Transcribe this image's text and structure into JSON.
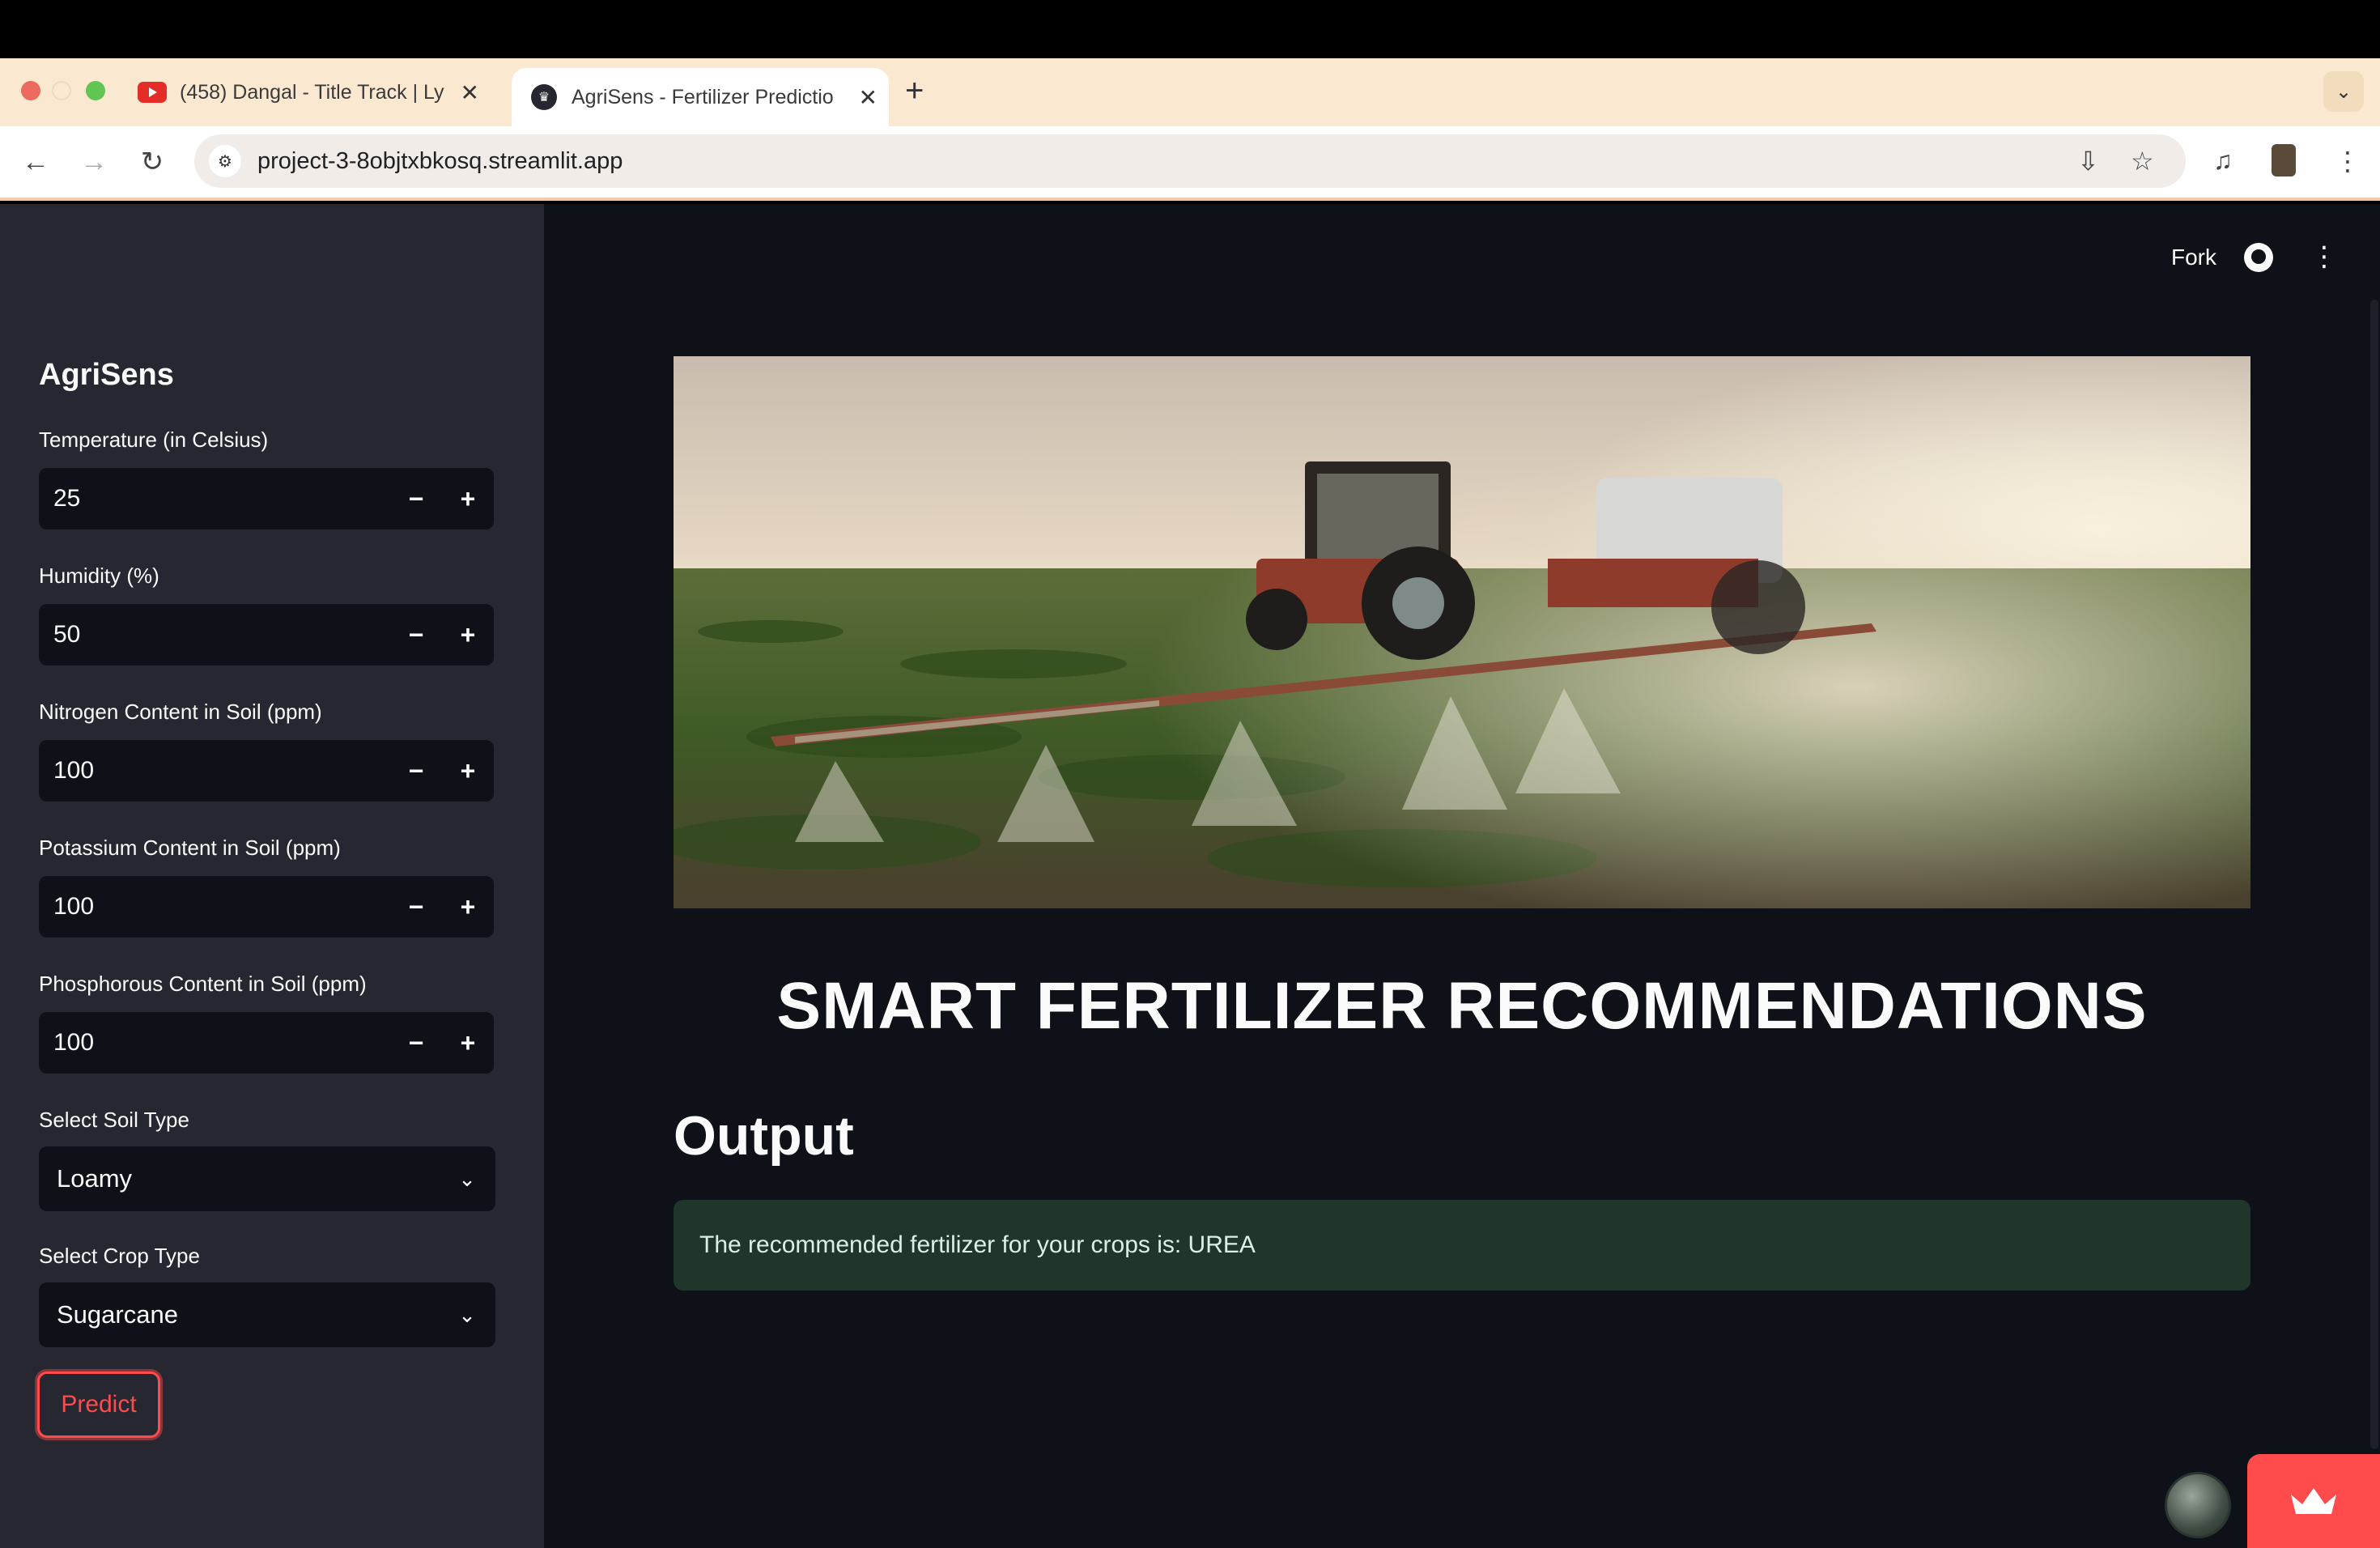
{
  "browser": {
    "tabs": [
      {
        "title": "(458) Dangal - Title Track | Ly",
        "active": false
      },
      {
        "title": "AgriSens - Fertilizer Predictio",
        "active": true
      }
    ],
    "url": "project-3-8objtxbkosq.streamlit.app"
  },
  "header": {
    "fork_label": "Fork"
  },
  "sidebar": {
    "brand": "AgriSens",
    "inputs": [
      {
        "label": "Temperature (in Celsius)",
        "value": "25"
      },
      {
        "label": "Humidity (%)",
        "value": "50"
      },
      {
        "label": "Nitrogen Content in Soil (ppm)",
        "value": "100"
      },
      {
        "label": "Potassium Content in Soil (ppm)",
        "value": "100"
      },
      {
        "label": "Phosphorous Content in Soil (ppm)",
        "value": "100"
      }
    ],
    "selects": [
      {
        "label": "Select Soil Type",
        "value": "Loamy"
      },
      {
        "label": "Select Crop Type",
        "value": "Sugarcane"
      }
    ],
    "predict_label": "Predict"
  },
  "main": {
    "title": "SMART FERTILIZER RECOMMENDATIONS",
    "output_heading": "Output",
    "result_text": "The recommended fertilizer for your crops is: UREA"
  },
  "colors": {
    "accent": "#ff4b4b",
    "sidebar_bg": "#262730",
    "main_bg": "#0e1117",
    "success_bg": "#21362a"
  }
}
